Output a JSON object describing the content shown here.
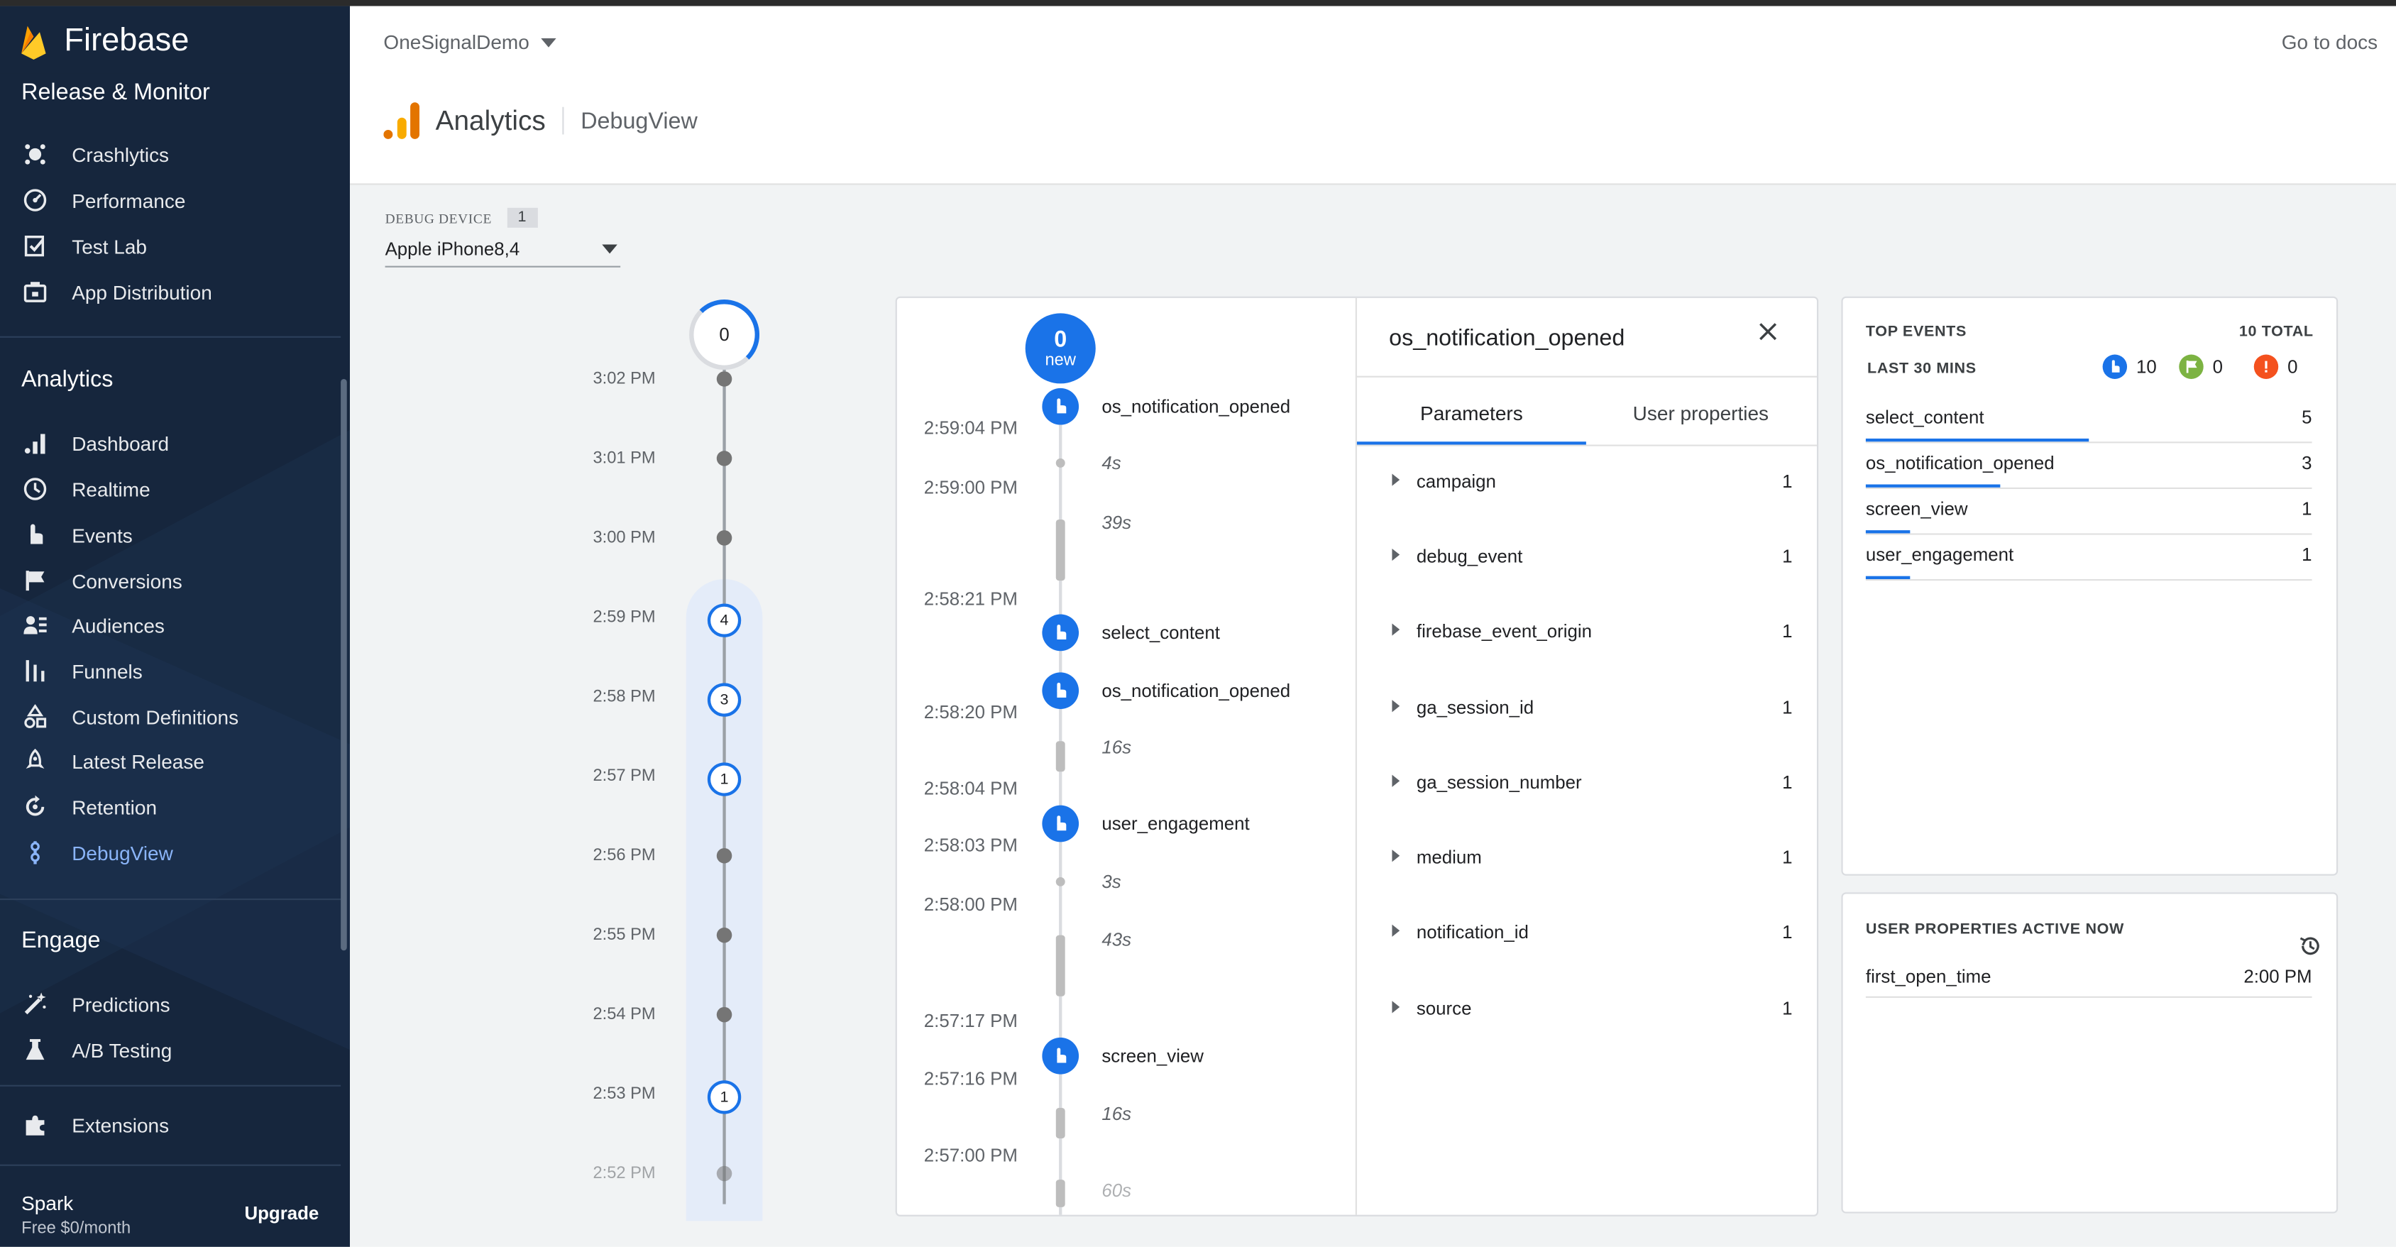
{
  "app": {
    "name": "Firebase",
    "project": "OneSignalDemo",
    "docs_link": "Go to docs"
  },
  "sidebar": {
    "release_section": "Release & Monitor",
    "release_items": [
      {
        "label": "Crashlytics",
        "icon": "crashlytics-icon"
      },
      {
        "label": "Performance",
        "icon": "performance-icon"
      },
      {
        "label": "Test Lab",
        "icon": "test-lab-icon"
      },
      {
        "label": "App Distribution",
        "icon": "app-distribution-icon"
      }
    ],
    "analytics_section": "Analytics",
    "analytics_items": [
      {
        "label": "Dashboard",
        "icon": "bar-chart-icon"
      },
      {
        "label": "Realtime",
        "icon": "clock-icon"
      },
      {
        "label": "Events",
        "icon": "touch-icon"
      },
      {
        "label": "Conversions",
        "icon": "flag-icon"
      },
      {
        "label": "Audiences",
        "icon": "audience-icon"
      },
      {
        "label": "Funnels",
        "icon": "funnel-icon"
      },
      {
        "label": "Custom Definitions",
        "icon": "shapes-icon"
      },
      {
        "label": "Latest Release",
        "icon": "rocket-icon"
      },
      {
        "label": "Retention",
        "icon": "retention-icon"
      },
      {
        "label": "DebugView",
        "icon": "debug-icon",
        "active": true
      }
    ],
    "engage_section": "Engage",
    "engage_items": [
      {
        "label": "Predictions",
        "icon": "magic-wand-icon"
      },
      {
        "label": "A/B Testing",
        "icon": "flask-icon"
      }
    ],
    "extensions": {
      "label": "Extensions",
      "icon": "puzzle-icon"
    },
    "plan": {
      "name": "Spark",
      "price": "Free $0/month",
      "upgrade": "Upgrade"
    }
  },
  "header": {
    "title": "Analytics",
    "subtitle": "DebugView"
  },
  "debug_device": {
    "label": "DEBUG DEVICE",
    "count": "1",
    "selected": "Apple iPhone8,4"
  },
  "minute_stream": {
    "current_count": "0",
    "rows": [
      {
        "time": "3:02 PM",
        "count": ""
      },
      {
        "time": "3:01 PM",
        "count": ""
      },
      {
        "time": "3:00 PM",
        "count": ""
      },
      {
        "time": "2:59 PM",
        "count": "4"
      },
      {
        "time": "2:58 PM",
        "count": "3"
      },
      {
        "time": "2:57 PM",
        "count": "1"
      },
      {
        "time": "2:56 PM",
        "count": ""
      },
      {
        "time": "2:55 PM",
        "count": ""
      },
      {
        "time": "2:54 PM",
        "count": ""
      },
      {
        "time": "2:53 PM",
        "count": "1"
      },
      {
        "time": "2:52 PM",
        "count": ""
      }
    ]
  },
  "seconds_stream": {
    "new_count": "0",
    "new_label": "new",
    "times": [
      "2:59:04 PM",
      "2:59:00 PM",
      "2:58:21 PM",
      "2:58:20 PM",
      "2:58:04 PM",
      "2:58:03 PM",
      "2:58:00 PM",
      "2:57:17 PM",
      "2:57:16 PM",
      "2:57:00 PM"
    ],
    "events": [
      "os_notification_opened",
      "select_content",
      "os_notification_opened",
      "user_engagement",
      "screen_view"
    ],
    "gaps": [
      "4s",
      "39s",
      "16s",
      "3s",
      "43s",
      "16s",
      "60s"
    ]
  },
  "event_detail": {
    "title": "os_notification_opened",
    "tabs": [
      "Parameters",
      "User properties"
    ],
    "parameters": [
      {
        "name": "campaign",
        "count": "1"
      },
      {
        "name": "debug_event",
        "count": "1"
      },
      {
        "name": "firebase_event_origin",
        "count": "1"
      },
      {
        "name": "ga_session_id",
        "count": "1"
      },
      {
        "name": "ga_session_number",
        "count": "1"
      },
      {
        "name": "medium",
        "count": "1"
      },
      {
        "name": "notification_id",
        "count": "1"
      },
      {
        "name": "source",
        "count": "1"
      }
    ]
  },
  "top_events": {
    "title": "TOP EVENTS",
    "total": "10 TOTAL",
    "window": "LAST 30 MINS",
    "stats": [
      {
        "kind": "events",
        "value": "10",
        "color": "#1a73e8"
      },
      {
        "kind": "conversions",
        "value": "0",
        "color": "#7cb342"
      },
      {
        "kind": "errors",
        "value": "0",
        "color": "#f4511e"
      }
    ],
    "rows": [
      {
        "name": "select_content",
        "count": "5",
        "share": 0.5
      },
      {
        "name": "os_notification_opened",
        "count": "3",
        "share": 0.3
      },
      {
        "name": "screen_view",
        "count": "1",
        "share": 0.1
      },
      {
        "name": "user_engagement",
        "count": "1",
        "share": 0.1
      }
    ]
  },
  "user_properties": {
    "title": "USER PROPERTIES ACTIVE NOW",
    "rows": [
      {
        "name": "first_open_time",
        "value": "2:00 PM"
      }
    ]
  },
  "colors": {
    "sidebar_bg": "#16263d",
    "accent": "#1a73e8",
    "active_nav": "#8ab4f8"
  }
}
